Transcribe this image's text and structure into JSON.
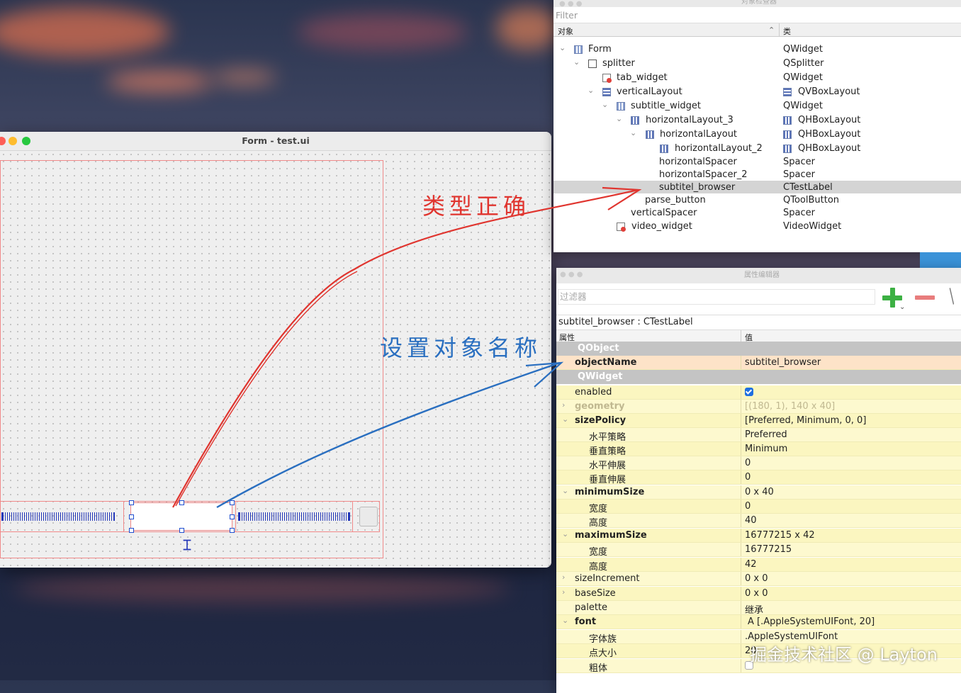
{
  "form_window": {
    "title": "Form - test.ui"
  },
  "object_inspector": {
    "title": "对象检查器",
    "filter_placeholder": "Filter",
    "col_object": "对象",
    "col_class": "类",
    "rows": [
      {
        "name": "Form",
        "cls": "QWidget"
      },
      {
        "name": "splitter",
        "cls": "QSplitter"
      },
      {
        "name": "tab_widget",
        "cls": "QWidget"
      },
      {
        "name": "verticalLayout",
        "cls": "QVBoxLayout"
      },
      {
        "name": "subtitle_widget",
        "cls": "QWidget"
      },
      {
        "name": "horizontalLayout_3",
        "cls": "QHBoxLayout"
      },
      {
        "name": "horizontalLayout",
        "cls": "QHBoxLayout"
      },
      {
        "name": "horizontalLayout_2",
        "cls": "QHBoxLayout"
      },
      {
        "name": "horizontalSpacer",
        "cls": "Spacer"
      },
      {
        "name": "horizontalSpacer_2",
        "cls": "Spacer"
      },
      {
        "name": "subtitel_browser",
        "cls": "CTestLabel"
      },
      {
        "name": "parse_button",
        "cls": "QToolButton"
      },
      {
        "name": "verticalSpacer",
        "cls": "Spacer"
      },
      {
        "name": "video_widget",
        "cls": "VideoWidget"
      }
    ]
  },
  "property_editor": {
    "title": "属性编辑器",
    "filter_placeholder": "过滤器",
    "object_line": "subtitel_browser : CTestLabel",
    "col_property": "属性",
    "col_value": "值",
    "rows": [
      {
        "name": "QObject",
        "value": ""
      },
      {
        "name": "objectName",
        "value": "subtitel_browser"
      },
      {
        "name": "QWidget",
        "value": ""
      },
      {
        "name": "enabled",
        "value": ""
      },
      {
        "name": "geometry",
        "value": "[(180, 1), 140 x 40]"
      },
      {
        "name": "sizePolicy",
        "value": "[Preferred, Minimum, 0, 0]"
      },
      {
        "name": "水平策略",
        "value": "Preferred"
      },
      {
        "name": "垂直策略",
        "value": "Minimum"
      },
      {
        "name": "水平伸展",
        "value": "0"
      },
      {
        "name": "垂直伸展",
        "value": "0"
      },
      {
        "name": "minimumSize",
        "value": "0 x 40"
      },
      {
        "name": "宽度",
        "value": "0"
      },
      {
        "name": "高度",
        "value": "40"
      },
      {
        "name": "maximumSize",
        "value": "16777215 x 42"
      },
      {
        "name": "宽度",
        "value": "16777215"
      },
      {
        "name": "高度",
        "value": "42"
      },
      {
        "name": "sizeIncrement",
        "value": "0 x 0"
      },
      {
        "name": "baseSize",
        "value": "0 x 0"
      },
      {
        "name": "palette",
        "value": "继承"
      },
      {
        "name": "font",
        "value": "A  [.AppleSystemUIFont, 20]"
      },
      {
        "name": "字体族",
        "value": ".AppleSystemUIFont"
      },
      {
        "name": "点大小",
        "value": "20"
      },
      {
        "name": "粗体",
        "value": ""
      }
    ],
    "enabled_checked": true,
    "bold_checked": false
  },
  "annotations": {
    "type_correct": "类型正确",
    "set_object_name": "设置对象名称",
    "red_color": "#e0352f",
    "blue_color": "#2a6fc0"
  },
  "watermark": "掘金技术社区 @ Layton"
}
